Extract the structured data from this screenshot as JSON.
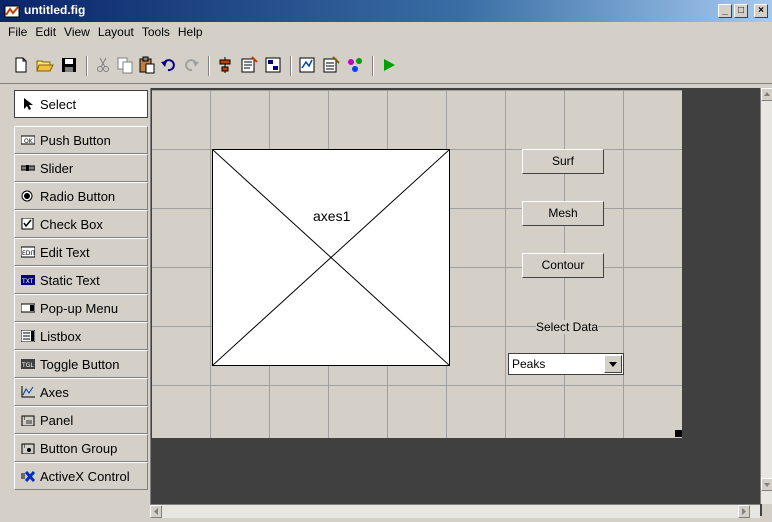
{
  "window": {
    "title": "untitled.fig",
    "minimize": "_",
    "maximize": "□",
    "close": "×"
  },
  "menu": [
    "File",
    "Edit",
    "View",
    "Layout",
    "Tools",
    "Help"
  ],
  "toolbar": [
    "new-icon",
    "open-icon",
    "save-icon",
    "cut-icon",
    "copy-icon",
    "paste-icon",
    "undo-icon",
    "redo-icon",
    "align-icon",
    "menu-editor-icon",
    "tab-order-icon",
    "mfile-editor-icon",
    "property-inspector-icon",
    "object-browser-icon",
    "run-icon"
  ],
  "palette": [
    {
      "label": "Select",
      "icon": "arrow-icon"
    },
    {
      "label": "Push Button",
      "icon": "push-button-icon"
    },
    {
      "label": "Slider",
      "icon": "slider-icon"
    },
    {
      "label": "Radio Button",
      "icon": "radio-button-icon"
    },
    {
      "label": "Check Box",
      "icon": "check-box-icon"
    },
    {
      "label": "Edit Text",
      "icon": "edit-text-icon"
    },
    {
      "label": "Static Text",
      "icon": "static-text-icon"
    },
    {
      "label": "Pop-up Menu",
      "icon": "popup-menu-icon"
    },
    {
      "label": "Listbox",
      "icon": "listbox-icon"
    },
    {
      "label": "Toggle Button",
      "icon": "toggle-button-icon"
    },
    {
      "label": "Axes",
      "icon": "axes-icon"
    },
    {
      "label": "Panel",
      "icon": "panel-icon"
    },
    {
      "label": "Button Group",
      "icon": "button-group-icon"
    },
    {
      "label": "ActiveX Control",
      "icon": "activex-icon"
    }
  ],
  "canvas": {
    "axes_label": "axes1",
    "buttons": [
      "Surf",
      "Mesh",
      "Contour"
    ],
    "static_text": "Select Data",
    "popup_value": "Peaks"
  }
}
